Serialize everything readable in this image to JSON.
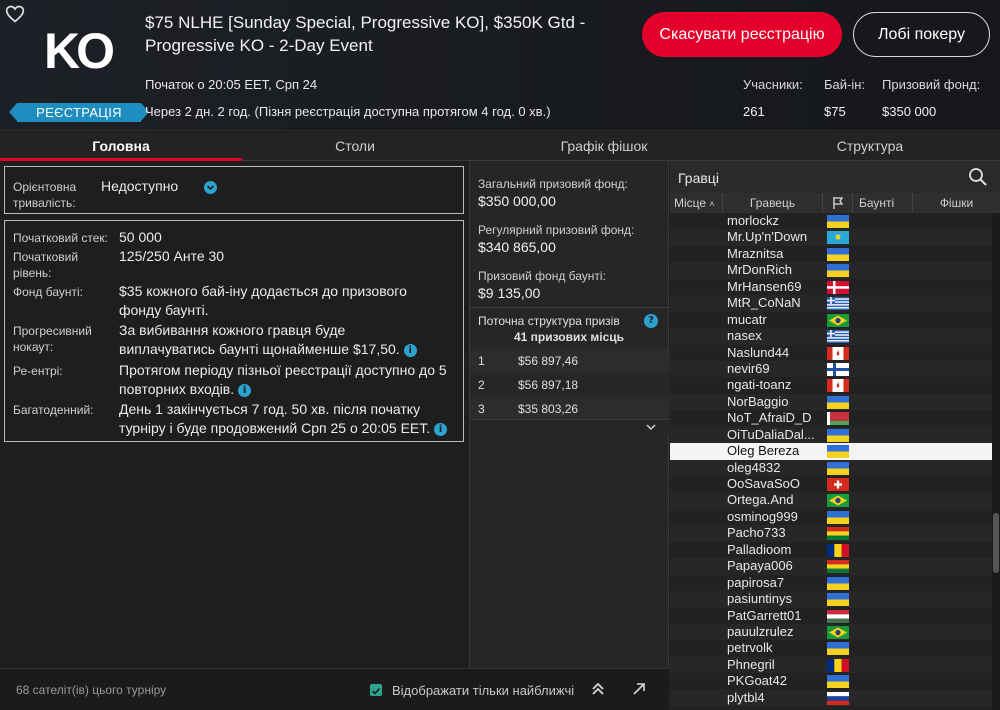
{
  "header": {
    "logo_text": "KO",
    "reg_badge": "РЕЄСТРАЦІЯ",
    "title": "$75 NLHE [Sunday Special, Progressive KO], $350K Gtd - Progressive KO - 2-Day Event",
    "start": "Початок о 20:05 EET, Срп 24",
    "countdown": "Через 2 дн. 2 год. (Пізня реєстрація доступна протягом 4 год. 0 хв.)",
    "cancel_btn": "Скасувати реєстрацію",
    "lobby_btn": "Лобі покеру",
    "stats": {
      "players_label": "Учасники:",
      "players_value": "261",
      "buyin_label": "Бай-ін:",
      "buyin_value": "$75",
      "prize_label": "Призовий фонд:",
      "prize_value": "$350 000"
    }
  },
  "tabs": [
    "Головна",
    "Столи",
    "Графік фішок",
    "Структура"
  ],
  "info": {
    "duration_label": "Орієнтовна тривалість:",
    "duration_value": "Недоступно",
    "rows": [
      {
        "label": "Початковий стек:",
        "value": "50 000"
      },
      {
        "label": "Початковий рівень:",
        "value": "125/250 Анте 30"
      },
      {
        "label": "Фонд баунті:",
        "value": "$35 кожного бай-іну додається до призового фонду баунті."
      },
      {
        "label": "Прогресивний нокаут:",
        "value": "За вибивання кожного гравця буде виплачуватись баунті щонайменше $17,50."
      },
      {
        "label": "Ре-ентрі:",
        "value": "Протягом періоду пізньої реєстрації доступно до 5 повторних входів."
      },
      {
        "label": "Багатоденний:",
        "value": "День 1 закінчується 7 год. 50 хв. після початку турніру і буде продовжений Срп 25 о 20:05 EET."
      }
    ]
  },
  "footer": {
    "satellites": "68 сателіт(ів) цього турніру",
    "nearest_only": "Відображати тільки найближчі"
  },
  "prize": {
    "total_label": "Загальний призовий фонд:",
    "total_value": "$350 000,00",
    "regular_label": "Регулярний призовий фонд:",
    "regular_value": "$340 865,00",
    "bounty_label": "Призовий фонд баунті:",
    "bounty_value": "$9 135,00",
    "structure_title": "Поточна структура призів",
    "structure_places": "41 призових місць",
    "rows": [
      {
        "pos": "1",
        "amount": "$56 897,46"
      },
      {
        "pos": "2",
        "amount": "$56 897,18"
      },
      {
        "pos": "3",
        "amount": "$35 803,26"
      }
    ]
  },
  "players": {
    "title": "Гравці",
    "columns": {
      "place": "Місце",
      "player": "Гравець",
      "bounty": "Баунті",
      "chips": "Фішки"
    },
    "list": [
      {
        "name": "morlockz",
        "flag": "ua"
      },
      {
        "name": "Mr.Up'n'Down",
        "flag": "kz"
      },
      {
        "name": "Mraznitsa",
        "flag": "ua"
      },
      {
        "name": "MrDonRich",
        "flag": "ua"
      },
      {
        "name": "MrHansen69",
        "flag": "dk"
      },
      {
        "name": "MtR_CoNaN",
        "flag": "gr"
      },
      {
        "name": "mucatr",
        "flag": "br"
      },
      {
        "name": "nasex",
        "flag": "gr"
      },
      {
        "name": "Naslund44",
        "flag": "ca"
      },
      {
        "name": "nevir69",
        "flag": "fi"
      },
      {
        "name": "ngati-toanz",
        "flag": "ca"
      },
      {
        "name": "NorBaggio",
        "flag": "ua"
      },
      {
        "name": "NoT_AfraiD_D",
        "flag": "by"
      },
      {
        "name": "OiTuDaliaDal...",
        "flag": "ua"
      },
      {
        "name": "Oleg Bereza",
        "flag": "ua"
      },
      {
        "name": "oleg4832",
        "flag": "ua"
      },
      {
        "name": "OoSavaSoO",
        "flag": "ch"
      },
      {
        "name": "Ortega.And",
        "flag": "br"
      },
      {
        "name": "osminog999",
        "flag": "ua"
      },
      {
        "name": "Pacho733",
        "flag": "bo"
      },
      {
        "name": "Palladioom",
        "flag": "ro"
      },
      {
        "name": "Papaya006",
        "flag": "bo"
      },
      {
        "name": "papirosa7",
        "flag": "ua"
      },
      {
        "name": "pasiuntinys",
        "flag": "ua"
      },
      {
        "name": "PatGarrett01",
        "flag": "hu"
      },
      {
        "name": "pauulzrulez",
        "flag": "br"
      },
      {
        "name": "petrvolk",
        "flag": "ua"
      },
      {
        "name": "Phnegril",
        "flag": "ro"
      },
      {
        "name": "PKGoat42",
        "flag": "ua"
      },
      {
        "name": "plytbl4",
        "flag": "ru"
      }
    ],
    "highlight": "Oleg Bereza"
  },
  "colors": {
    "accent": "#e4002b",
    "info": "#2aa3d0",
    "badge": "#1e8dbf"
  }
}
